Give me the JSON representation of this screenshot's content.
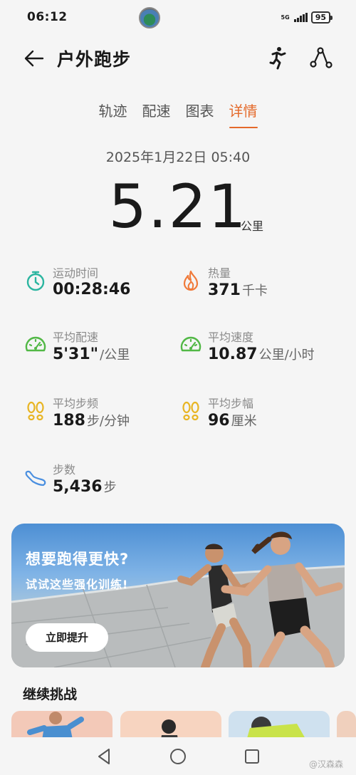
{
  "status_bar": {
    "time": "06:12",
    "network": "5G",
    "battery": "95"
  },
  "header": {
    "title": "户外跑步"
  },
  "tabs": [
    {
      "label": "轨迹",
      "active": false
    },
    {
      "label": "配速",
      "active": false
    },
    {
      "label": "图表",
      "active": false
    },
    {
      "label": "详情",
      "active": true
    }
  ],
  "record": {
    "date": "2025年1月22日 05:40",
    "distance": "5.21",
    "distance_unit": "公里"
  },
  "metrics": {
    "duration": {
      "label": "运动时间",
      "value": "00:28:46",
      "unit": "",
      "icon": "stopwatch-icon",
      "color": "#2bb5a0"
    },
    "calories": {
      "label": "热量",
      "value": "371",
      "unit": "千卡",
      "icon": "flame-icon",
      "color": "#f07a3a"
    },
    "avg_pace": {
      "label": "平均配速",
      "value": "5'31\"",
      "unit": "/公里",
      "icon": "speedometer-icon",
      "color": "#52b846"
    },
    "avg_speed": {
      "label": "平均速度",
      "value": "10.87",
      "unit": "公里/小时",
      "icon": "speedometer-icon",
      "color": "#52b846"
    },
    "avg_cadence": {
      "label": "平均步频",
      "value": "188",
      "unit": "步/分钟",
      "icon": "footprints-icon",
      "color": "#e8b524"
    },
    "avg_stride": {
      "label": "平均步幅",
      "value": "96",
      "unit": "厘米",
      "icon": "footprints-icon",
      "color": "#e8b524"
    },
    "steps": {
      "label": "步数",
      "value": "5,436",
      "unit": "步",
      "icon": "shoe-icon",
      "color": "#4a8fe0"
    }
  },
  "banner": {
    "title": "想要跑得更快?",
    "subtitle": "试试这些强化训练!",
    "button": "立即提升"
  },
  "challenge": {
    "title": "继续挑战"
  },
  "watermark": "@汉森森"
}
